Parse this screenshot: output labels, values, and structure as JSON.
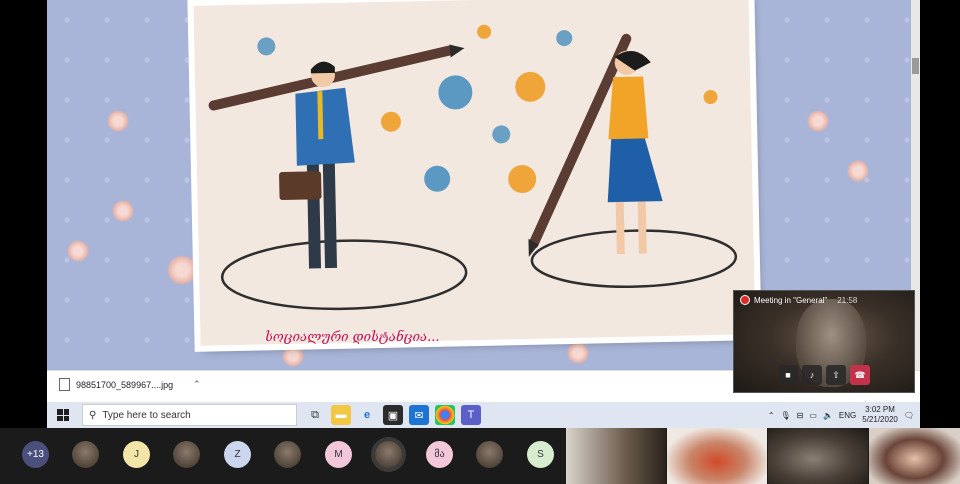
{
  "slide": {
    "caption": "სოციალური დისტანცია..."
  },
  "download_bar": {
    "file_name": "98851700_589967....jpg"
  },
  "taskbar": {
    "search_placeholder": "Type here to search",
    "tray": {
      "language": "ENG",
      "time": "3:02 PM",
      "date": "5/21/2020"
    }
  },
  "meeting_overlay": {
    "title": "Meeting in \"General\"",
    "duration": "21:58"
  },
  "participants": {
    "overflow_count": "+13",
    "initials": [
      {
        "label": "J",
        "color": "#f3e4a8"
      },
      {
        "label": "Z",
        "color": "#c9d6ee"
      },
      {
        "label": "M",
        "color": "#f2c7d9"
      },
      {
        "label": "მა",
        "color": "#f2c7d9"
      },
      {
        "label": "S",
        "color": "#d8ecd0"
      }
    ]
  }
}
